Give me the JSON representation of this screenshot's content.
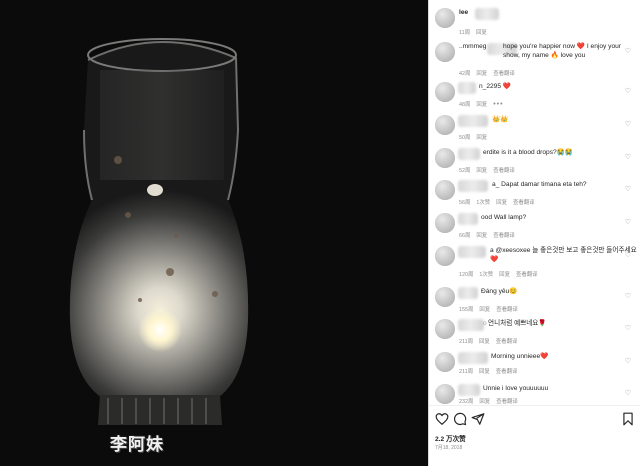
{
  "post": {
    "caption_user": "lee",
    "caption_time": "11周",
    "caption_reply": "回复",
    "likes": "2.2 万次赞",
    "date": "7月18, 2018"
  },
  "comments": [
    {
      "text": "hope you're happier now ❤️ I enjoy your show, my name 🔥 love you",
      "prefix": "..mmmeg",
      "time": "42周",
      "reply": "回复",
      "translate": "查看翻译"
    },
    {
      "text": "n_2295 ❤️",
      "prefix": "",
      "time": "48周",
      "reply": "回复",
      "translate": "",
      "more": "•••"
    },
    {
      "text": "👑👑",
      "prefix": "a",
      "time": "50周",
      "reply": "回复",
      "translate": ""
    },
    {
      "text": "erdite is it a blood drops?😭😭",
      "prefix": "",
      "time": "52周",
      "reply": "回复",
      "translate": "查看翻译"
    },
    {
      "text": "a_ Dapat damar timana eta teh?",
      "prefix": "",
      "time": "56周",
      "reply": "1次赞",
      "translate": "回复",
      "extra": "查看翻译"
    },
    {
      "text": "ood Wall lamp?",
      "prefix": "",
      "time": "66周",
      "reply": "回复",
      "translate": "查看翻译"
    },
    {
      "text": "a @xeesoxee 늘 좋은것만 보고 좋은것만 들어주세요❤️",
      "prefix": "",
      "time": "120周",
      "reply": "1次赞",
      "translate": "回复",
      "extra": "查看翻译"
    },
    {
      "text": "Đáng yêu😊",
      "prefix": "",
      "time": "155周",
      "reply": "回复",
      "translate": "查看翻译"
    },
    {
      "text": "언니처럼 예쁘네요🌹",
      "prefix": "o",
      "time": "211周",
      "reply": "回复",
      "translate": "查看翻译"
    },
    {
      "text": "Morning unnieee❤️",
      "prefix": "",
      "time": "211周",
      "reply": "回复",
      "translate": "查看翻译"
    },
    {
      "text": "Unnie i love youuuuuu",
      "prefix": "",
      "time": "232周",
      "reply": "回复",
      "translate": "查看翻译"
    }
  ],
  "icons": {
    "like": "heart-icon",
    "comment": "comment-icon",
    "share": "send-icon",
    "save": "bookmark-icon"
  },
  "watermark": "李阿妹",
  "colors": {
    "accent_heart": "#ed4956",
    "text": "#262626",
    "muted": "#8e8e8e"
  }
}
